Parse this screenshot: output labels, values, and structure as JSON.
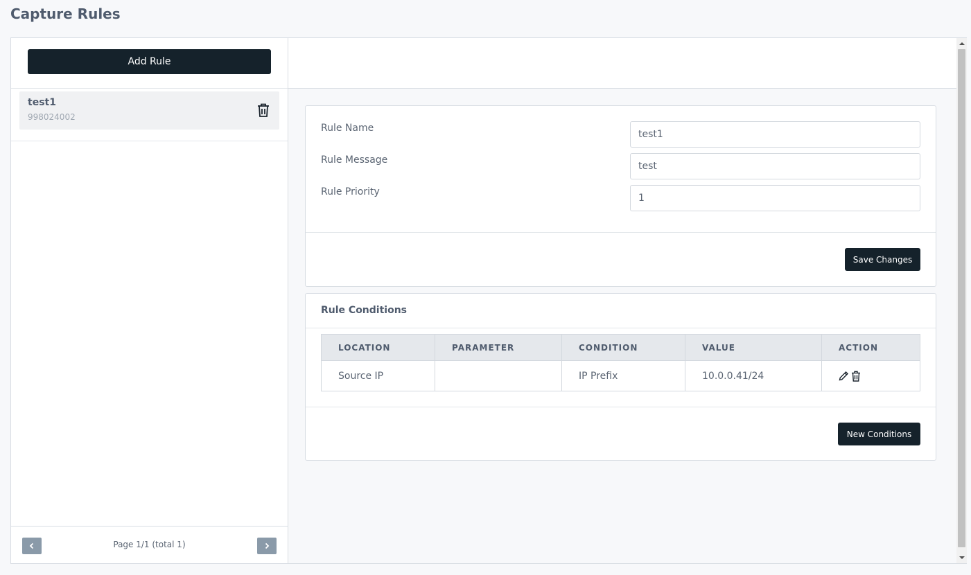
{
  "page": {
    "title": "Capture Rules"
  },
  "sidebar": {
    "add_button_label": "Add Rule",
    "rules": [
      {
        "name": "test1",
        "id": "998024002",
        "delete_icon": "trash-icon"
      }
    ],
    "pager": {
      "text": "Page 1/1 (total 1)",
      "prev_icon": "chevron-left-icon",
      "next_icon": "chevron-right-icon"
    }
  },
  "form": {
    "rule_name_label": "Rule Name",
    "rule_name_value": "test1",
    "rule_message_label": "Rule Message",
    "rule_message_value": "test",
    "rule_priority_label": "Rule Priority",
    "rule_priority_value": "1",
    "save_label": "Save Changes"
  },
  "conditions": {
    "title": "Rule Conditions",
    "headers": [
      "LOCATION",
      "PARAMETER",
      "CONDITION",
      "VALUE",
      "ACTION"
    ],
    "rows": [
      {
        "location": "Source IP",
        "parameter": "",
        "condition": "IP Prefix",
        "value": "10.0.0.41/24",
        "actions": [
          "pencil-icon",
          "trash-icon"
        ]
      }
    ],
    "new_label": "New Conditions"
  },
  "colors": {
    "primary_button": "#15222b",
    "pager_button": "#8a9aa9",
    "border": "#d8dde3"
  }
}
